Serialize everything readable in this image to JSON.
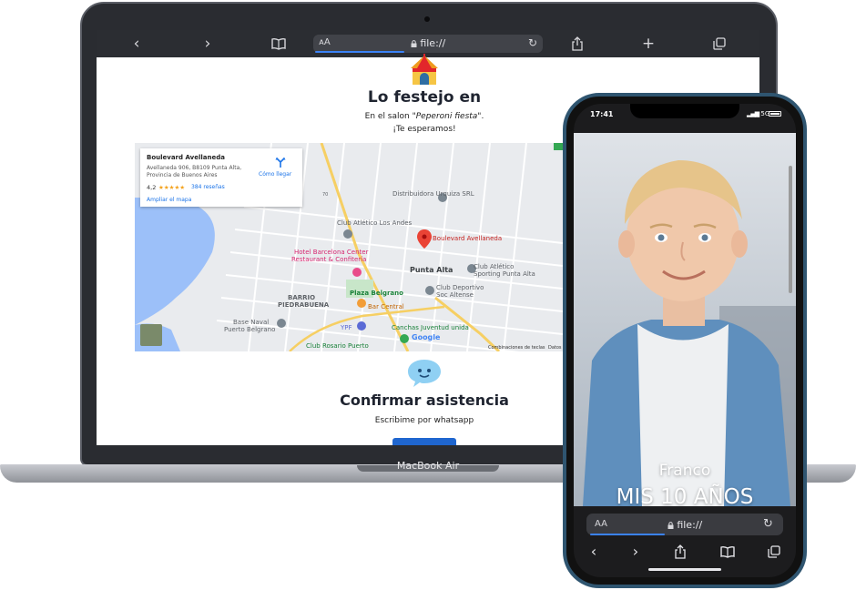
{
  "laptop": {
    "device_label": "MacBook Air",
    "toolbar": {
      "back_icon": "‹",
      "forward_icon": "›",
      "bookmarks_icon": "book-icon",
      "aa": "ᴀA",
      "lock_icon": "lock-icon",
      "url": "file://",
      "reload_icon": "↻",
      "share_icon": "share-icon",
      "new_tab_icon": "+",
      "tabs_icon": "tabs-icon"
    },
    "page": {
      "title": "Lo festejo en",
      "line1_prefix": "En el salon ",
      "line1_venue": "\"Peperoni fiesta\"",
      "line1_suffix": ".",
      "line2": "¡Te esperamos!",
      "map": {
        "place_name": "Boulevard Avellaneda",
        "address": "Avellaneda 906, B8109 Punta Alta, Provincia de Buenos Aires",
        "rating": "4,2",
        "stars": "★★★★★",
        "reviews": "384 reseñas",
        "enlarge": "Ampliar el mapa",
        "directions": "Cómo llegar",
        "labels": {
          "distribuidora": "Distribuidora Urquiza SRL",
          "club_andes": "Club Atlético Los Andes",
          "boulevard": "Boulevard Avellaneda",
          "hotel": "Hotel Barcelona Center",
          "hotel2": "Restaurant & Confitería",
          "punta_alta": "Punta Alta",
          "club_sporting": "Club Atlético",
          "club_sporting2": "Sporting Punta Alta",
          "barrio": "BARRIO",
          "barrio2": "PIEDRABUENA",
          "plaza": "Plaza Belgrano",
          "bar": "Bar Central",
          "club_deportivo": "Club Deportivo",
          "club_deportivo2": "Soc Altense",
          "base_naval": "Base Naval",
          "base_naval2": "Puerto Belgrano",
          "ypf": "YPF",
          "canchas": "Canchas Juventud unida",
          "club_rosario": "Club Rosario Puerto",
          "google": "Google",
          "shortcuts": "Combinaciones de teclas",
          "datos": "Datos",
          "route_70": "70"
        }
      },
      "confirm_title": "Confirmar asistencia",
      "confirm_sub": "Escribime por whatsapp"
    }
  },
  "phone": {
    "time": "17:41",
    "signal": "5G",
    "name": "Franco",
    "age": "MIS 10 AÑOS",
    "toolbar": {
      "aa": "AA",
      "url": "file://",
      "reload_icon": "↻",
      "back_icon": "‹",
      "forward_icon": "›",
      "share_icon": "share-icon",
      "bookmarks_icon": "book-icon",
      "tabs_icon": "tabs-icon"
    }
  },
  "colors": {
    "laptop_frame": "#2a2c31",
    "browser_bar": "#2b2d32",
    "accent_blue": "#1f66cf",
    "map_water": "#9cc0f9",
    "map_pin": "#ea4335",
    "phone_frame": "#2f5570"
  }
}
